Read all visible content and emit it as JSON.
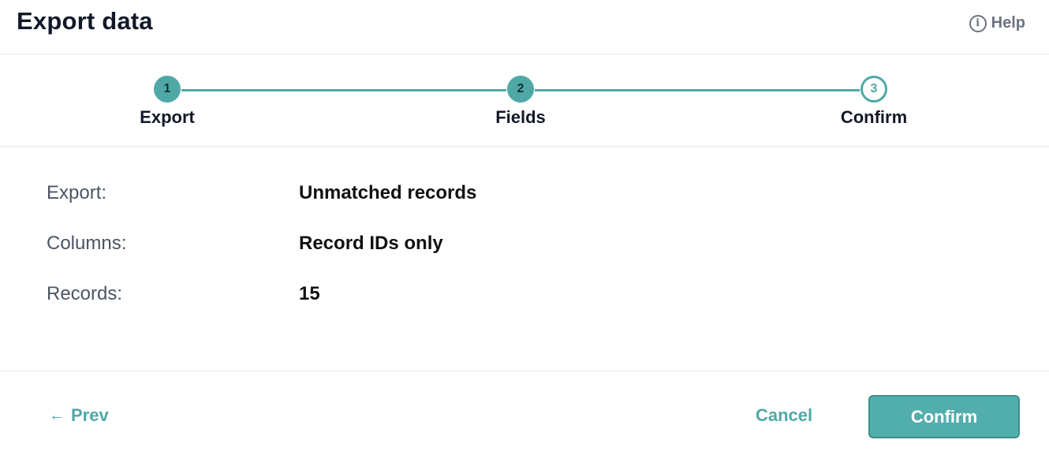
{
  "header": {
    "title": "Export data",
    "help_label": "Help",
    "help_icon_glyph": "i"
  },
  "stepper": {
    "steps": [
      {
        "number": "1",
        "label": "Export",
        "state": "done"
      },
      {
        "number": "2",
        "label": "Fields",
        "state": "done"
      },
      {
        "number": "3",
        "label": "Confirm",
        "state": "active"
      }
    ]
  },
  "summary": {
    "rows": [
      {
        "key": "Export:",
        "value": "Unmatched records"
      },
      {
        "key": "Columns:",
        "value": "Record IDs only"
      },
      {
        "key": "Records:",
        "value": "15"
      }
    ]
  },
  "footer": {
    "prev_label": "Prev",
    "prev_arrow": "←",
    "cancel_label": "Cancel",
    "confirm_label": "Confirm"
  },
  "colors": {
    "accent": "#4fa8a6",
    "divider": "#e5e7eb"
  },
  "icons": {
    "help": "info-circle-icon",
    "prev": "arrow-left-icon"
  }
}
